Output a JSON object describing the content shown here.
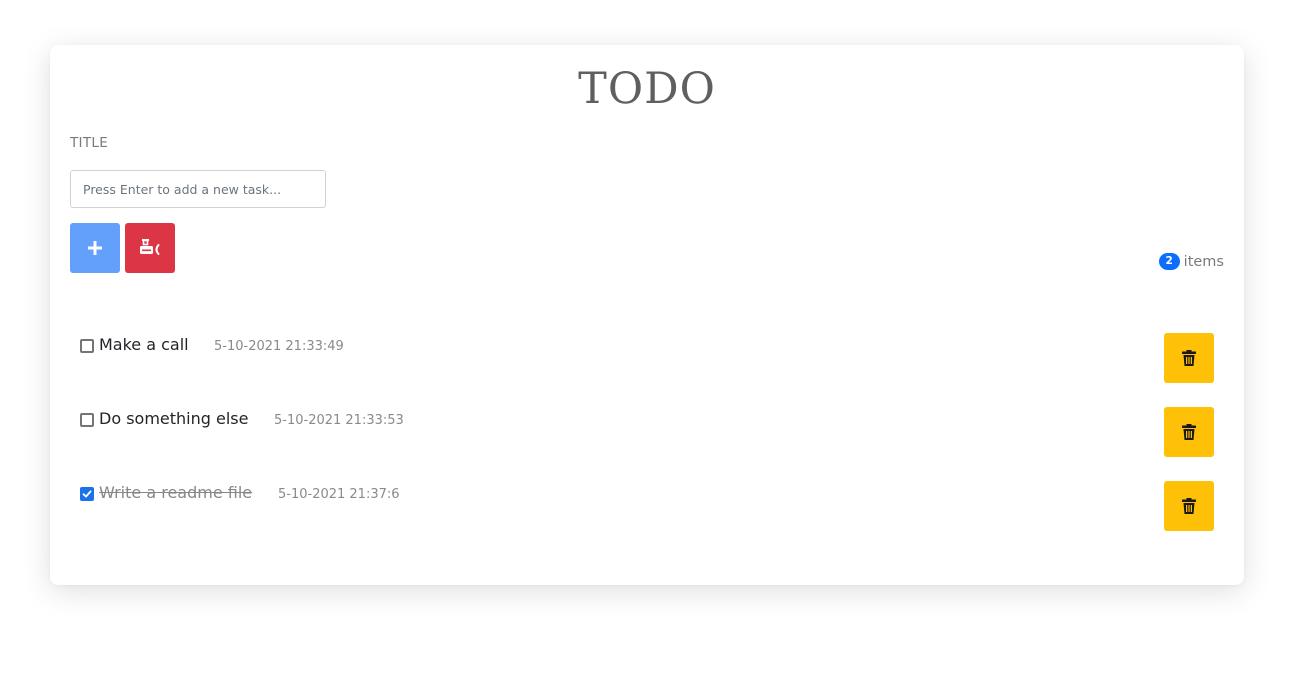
{
  "app": {
    "title": "TODO"
  },
  "form": {
    "label": "TITLE",
    "input_value": "",
    "input_placeholder": "Press Enter to add a new task...",
    "add_icon": "plus-icon",
    "clear_icon": "trash-restore-icon"
  },
  "counter": {
    "count": "2",
    "label": "items"
  },
  "todos": [
    {
      "text": "Make a call",
      "time": "5-10-2021 21:33:49",
      "done": false,
      "delete_icon": "trash-icon"
    },
    {
      "text": "Do something else",
      "time": "5-10-2021 21:33:53",
      "done": false,
      "delete_icon": "trash-icon"
    },
    {
      "text": "Write a readme file",
      "time": "5-10-2021 21:37:6",
      "done": true,
      "delete_icon": "trash-icon"
    }
  ],
  "colors": {
    "add_button": "#62a0fb",
    "clear_button": "#dc3545",
    "delete_button": "#ffc107",
    "badge": "#0d6efd",
    "checkbox_checked": "#1a73e8"
  }
}
